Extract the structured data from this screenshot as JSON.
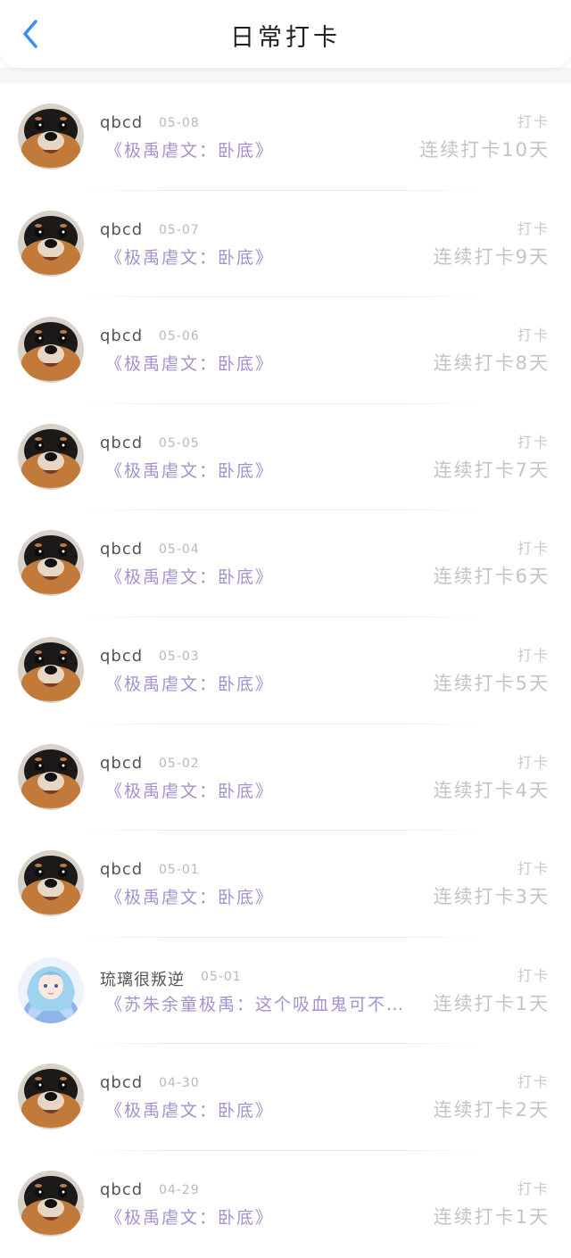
{
  "header": {
    "title": "日常打卡"
  },
  "items": [
    {
      "user": "qbcd",
      "date": "05-08",
      "book": "《极禹虐文：卧底》",
      "label": "打卡",
      "streak": "连续打卡10天",
      "avatar": "dog"
    },
    {
      "user": "qbcd",
      "date": "05-07",
      "book": "《极禹虐文：卧底》",
      "label": "打卡",
      "streak": "连续打卡9天",
      "avatar": "dog"
    },
    {
      "user": "qbcd",
      "date": "05-06",
      "book": "《极禹虐文：卧底》",
      "label": "打卡",
      "streak": "连续打卡8天",
      "avatar": "dog"
    },
    {
      "user": "qbcd",
      "date": "05-05",
      "book": "《极禹虐文：卧底》",
      "label": "打卡",
      "streak": "连续打卡7天",
      "avatar": "dog"
    },
    {
      "user": "qbcd",
      "date": "05-04",
      "book": "《极禹虐文：卧底》",
      "label": "打卡",
      "streak": "连续打卡6天",
      "avatar": "dog"
    },
    {
      "user": "qbcd",
      "date": "05-03",
      "book": "《极禹虐文：卧底》",
      "label": "打卡",
      "streak": "连续打卡5天",
      "avatar": "dog"
    },
    {
      "user": "qbcd",
      "date": "05-02",
      "book": "《极禹虐文：卧底》",
      "label": "打卡",
      "streak": "连续打卡4天",
      "avatar": "dog"
    },
    {
      "user": "qbcd",
      "date": "05-01",
      "book": "《极禹虐文：卧底》",
      "label": "打卡",
      "streak": "连续打卡3天",
      "avatar": "dog"
    },
    {
      "user": "琉璃很叛逆",
      "date": "05-01",
      "book": "《苏朱余童极禹：这个吸血鬼可不…",
      "label": "打卡",
      "streak": "连续打卡1天",
      "avatar": "anime"
    },
    {
      "user": "qbcd",
      "date": "04-30",
      "book": "《极禹虐文：卧底》",
      "label": "打卡",
      "streak": "连续打卡2天",
      "avatar": "dog"
    },
    {
      "user": "qbcd",
      "date": "04-29",
      "book": "《极禹虐文：卧底》",
      "label": "打卡",
      "streak": "连续打卡1天",
      "avatar": "dog"
    }
  ],
  "colors": {
    "accent": "#3a8ef6",
    "book": "#a691cf",
    "muted": "#c4c4c4"
  }
}
